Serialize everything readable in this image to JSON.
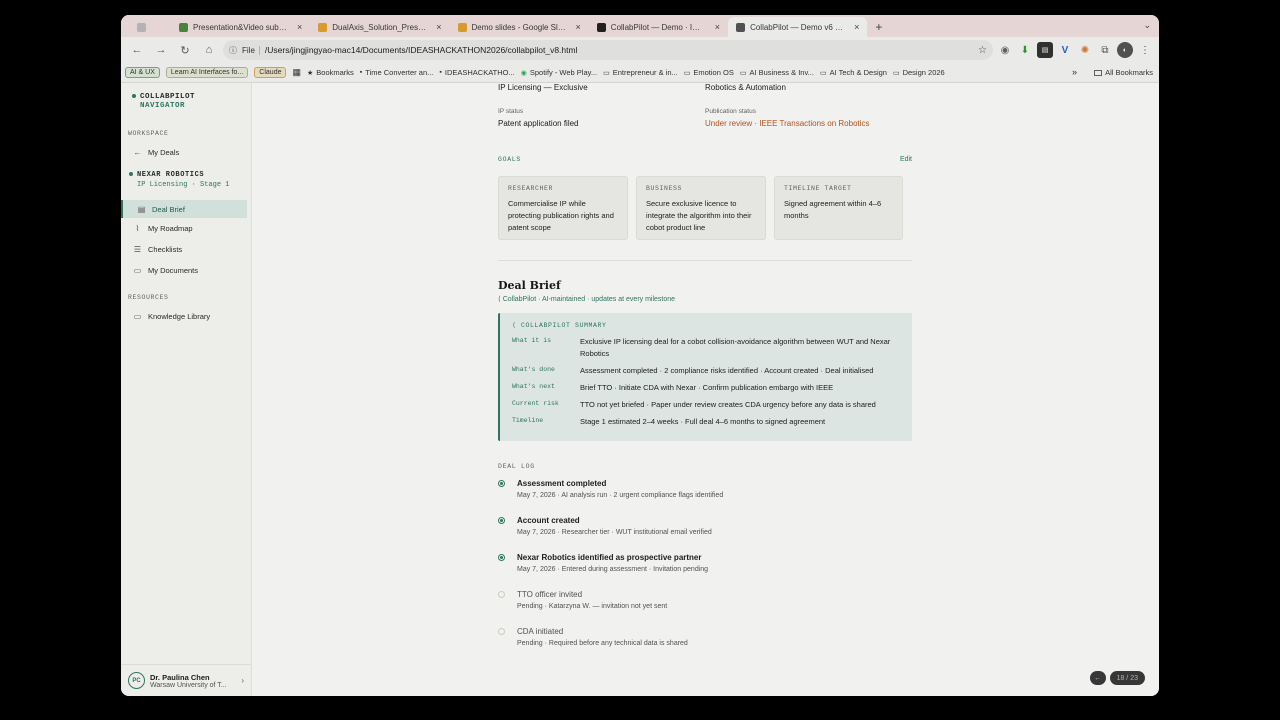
{
  "browser": {
    "tabs": [
      {
        "title": "",
        "color": "#bbbbbb",
        "pinned": true
      },
      {
        "title": "Presentation&Video submiss",
        "color": "#4a8a3c"
      },
      {
        "title": "DualAxis_Solution_Presenta",
        "color": "#e0a22e"
      },
      {
        "title": "Demo slides - Google Slides",
        "color": "#e0a22e"
      },
      {
        "title": "CollabPilot — Demo · IDEAS",
        "color": "#222222"
      },
      {
        "title": "CollabPilot — Demo v6 · IDE",
        "color": "#555555",
        "active": true
      }
    ],
    "new_tab": "+",
    "tabs_menu": "⌄",
    "file_label": "File",
    "url": "/Users/jingjingyao-mac14/Documents/IDEASHACKATHON2026/collabpilot_v8.html",
    "bookmarks": {
      "chips": [
        {
          "label": "AI & UX",
          "style": "green"
        },
        {
          "label": "Learn AI Interfaces fo...",
          "style": "plain"
        },
        {
          "label": "Claude",
          "style": "orange"
        }
      ],
      "items": [
        {
          "label": "Bookmarks",
          "icon": "star-icon"
        },
        {
          "label": "Time Converter an...",
          "icon": "link-icon"
        },
        {
          "label": "IDEASHACKATHO...",
          "icon": "link-icon"
        },
        {
          "label": "Spotify - Web Play...",
          "icon": "spotify-icon"
        },
        {
          "label": "Entrepreneur & in...",
          "icon": "folder-icon"
        },
        {
          "label": "Emotion OS",
          "icon": "folder-icon"
        },
        {
          "label": "AI Business & Inv...",
          "icon": "folder-icon"
        },
        {
          "label": "AI Tech & Design",
          "icon": "folder-icon"
        },
        {
          "label": "Design 2026",
          "icon": "folder-icon"
        }
      ],
      "more": "»",
      "all": "All Bookmarks"
    }
  },
  "sidebar": {
    "brand_line1": "COLLABPILOT",
    "brand_line2": "NAVIGATOR",
    "workspace_label": "WORKSPACE",
    "my_deals": "My Deals",
    "deal_name": "NEXAR ROBOTICS",
    "deal_stage": "IP Licensing · Stage 1",
    "nav": [
      {
        "label": "Deal Brief",
        "icon": "document-icon",
        "active": true
      },
      {
        "label": "My Roadmap",
        "icon": "roadmap-icon"
      },
      {
        "label": "Checklists",
        "icon": "checklist-icon"
      },
      {
        "label": "My Documents",
        "icon": "folder-icon"
      }
    ],
    "resources_label": "RESOURCES",
    "knowledge": "Knowledge Library",
    "user": {
      "initials": "PC",
      "name": "Dr. Paulina Chen",
      "org": "Warsaw University of T..."
    }
  },
  "main": {
    "deal_type_value": "IP Licensing — Exclusive",
    "sector_value": "Robotics & Automation",
    "ip_status_label": "IP status",
    "ip_status_value": "Patent application filed",
    "pub_status_label": "Publication status",
    "pub_status_value": "Under review · IEEE Transactions on Robotics",
    "goals_label": "GOALS",
    "edit_label": "Edit",
    "goals": [
      {
        "label": "RESEARCHER",
        "text": "Commercialise IP while protecting publication rights and patent scope"
      },
      {
        "label": "BUSINESS",
        "text": "Secure exclusive licence to integrate the algorithm into their cobot product line"
      },
      {
        "label": "TIMELINE TARGET",
        "text": "Signed agreement within 4–6 months"
      }
    ],
    "brief_title": "Deal Brief",
    "brief_sub": "CollabPilot · AI-maintained · updates at every milestone",
    "summary_label": "COLLABPILOT SUMMARY",
    "summary": [
      {
        "k": "What it is",
        "v": "Exclusive IP licensing deal for a cobot collision-avoidance algorithm between WUT and Nexar Robotics"
      },
      {
        "k": "What's done",
        "v": "Assessment completed · 2 compliance risks identified · Account created · Deal initialised"
      },
      {
        "k": "What's next",
        "v": "Brief TTO · Initiate CDA with Nexar · Confirm publication embargo with IEEE"
      },
      {
        "k": "Current risk",
        "v": "TTO not yet briefed · Paper under review creates CDA urgency before any data is shared"
      },
      {
        "k": "Timeline",
        "v": "Stage 1 estimated 2–4 weeks · Full deal 4–6 months to signed agreement"
      }
    ],
    "log_label": "DEAL LOG",
    "log": [
      {
        "title": "Assessment completed",
        "sub": "May 7, 2026 · AI analysis run · 2 urgent compliance flags identified",
        "done": true
      },
      {
        "title": "Account created",
        "sub": "May 7, 2026 · Researcher tier · WUT institutional email verified",
        "done": true
      },
      {
        "title": "Nexar Robotics identified as prospective partner",
        "sub": "May 7, 2026 · Entered during assessment · Invitation pending",
        "done": true
      },
      {
        "title": "TTO officer invited",
        "sub": "Pending · Katarzyna W. — invitation not yet sent",
        "done": false
      },
      {
        "title": "CDA initiated",
        "sub": "Pending · Required before any technical data is shared",
        "done": false
      }
    ],
    "pager": "18 / 23"
  }
}
